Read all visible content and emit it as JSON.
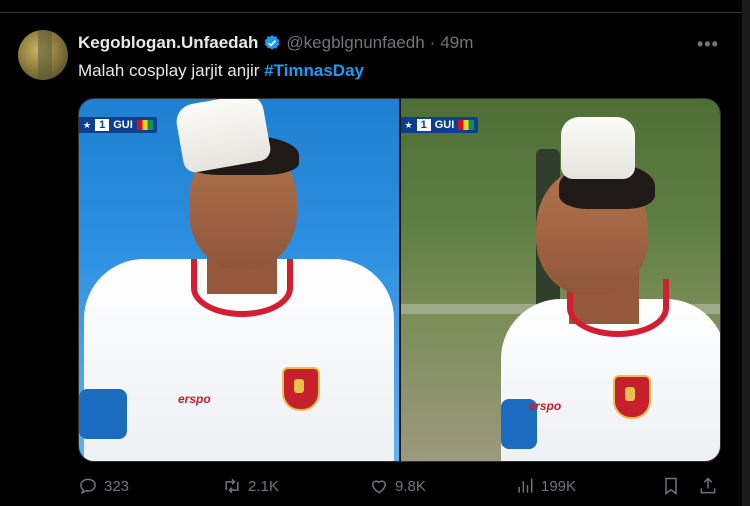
{
  "tweet": {
    "author_name": "Kegoblogan.Unfaedah",
    "handle": "@kegblgnunfaedh",
    "separator": "·",
    "time": "49m",
    "more_label": "•••",
    "text_plain": "Malah cosplay jarjit anjir ",
    "hashtag": "#TimnasDay"
  },
  "media": {
    "left": {
      "scorebug_num": "1",
      "scorebug_team": "GUI",
      "kit_brand": "erspo"
    },
    "right": {
      "scorebug_num": "1",
      "scorebug_team": "GUI",
      "kit_brand": "erspo"
    }
  },
  "actions": {
    "replies": "323",
    "reposts": "2.1K",
    "likes": "9.8K",
    "views": "199K"
  },
  "colors": {
    "accent": "#1d9bf0",
    "muted": "#71767b",
    "background": "#000000"
  }
}
